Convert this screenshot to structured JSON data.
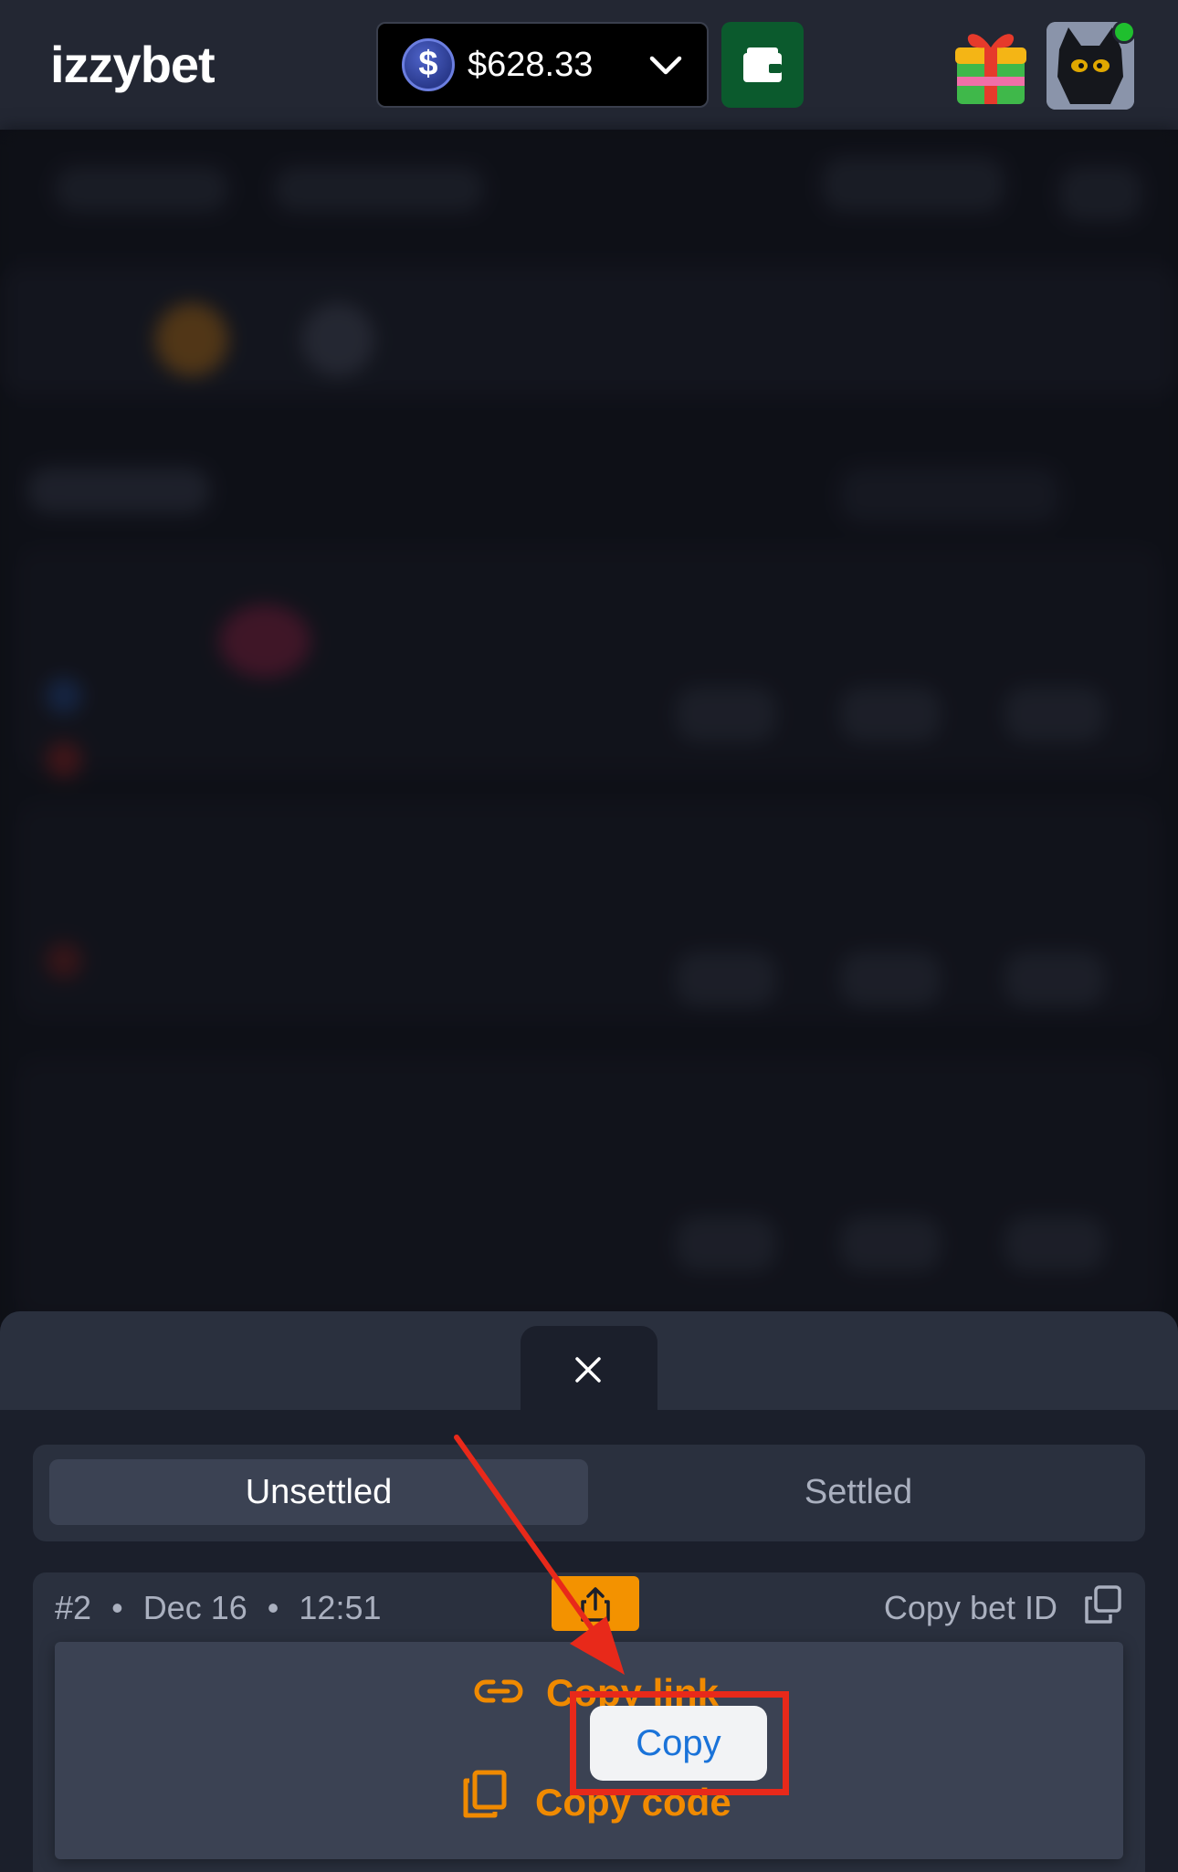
{
  "header": {
    "logo": "izzybet",
    "balance": "$628.33",
    "currency_symbol": "$",
    "icons": {
      "balance_dropdown": "chevron-down-icon",
      "wallet": "wallet-icon",
      "gift": "gift-icon",
      "avatar": "cat-avatar"
    },
    "colors": {
      "wallet_button": "#0b5a2d",
      "online_dot": "#1fbf2e"
    }
  },
  "sheet": {
    "close_icon": "close-icon",
    "tabs": [
      {
        "label": "Unsettled",
        "active": true
      },
      {
        "label": "Settled",
        "active": false
      }
    ],
    "bet": {
      "number": "#2",
      "date": "Dec 16",
      "time": "12:51",
      "copy_bet_id_label": "Copy bet ID",
      "share_icon": "share-icon"
    },
    "dropdown": {
      "items": [
        {
          "label": "Copy link",
          "icon": "link-icon"
        },
        {
          "label": "Copy code",
          "icon": "copy-icon"
        }
      ]
    },
    "callout": {
      "label": "Copy"
    },
    "colors": {
      "accent": "#f39200",
      "annotation": "#e8291a"
    }
  }
}
